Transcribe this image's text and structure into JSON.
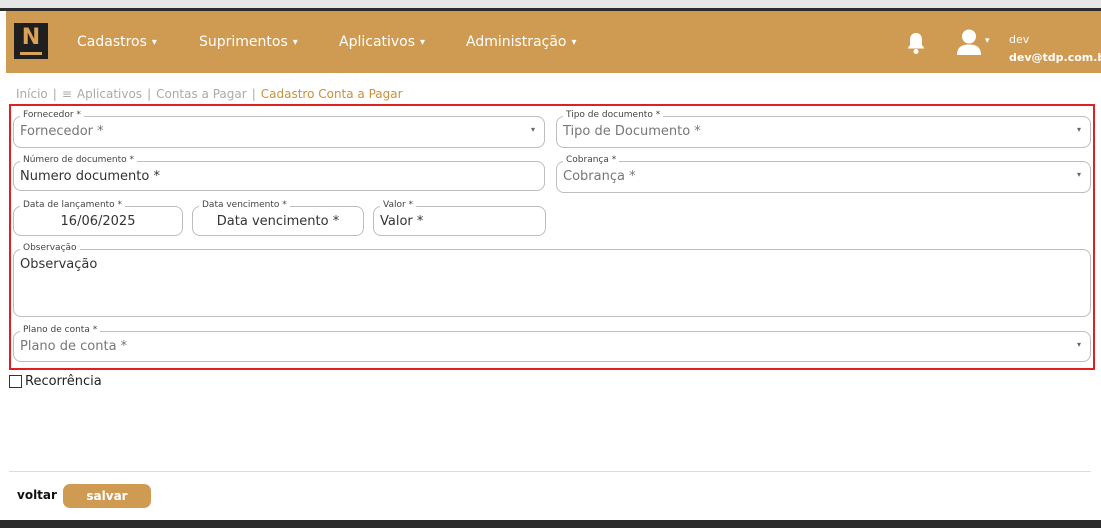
{
  "brand": {
    "logo_letter": "N",
    "accent": "#cf9a52",
    "logo_bg": "#1f1f1f"
  },
  "nav": {
    "items": [
      {
        "label": "Cadastros",
        "caret": "▾"
      },
      {
        "label": "Suprimentos",
        "caret": "▾"
      },
      {
        "label": "Aplicativos",
        "caret": "▾"
      },
      {
        "label": "Administração",
        "caret": "▾"
      }
    ],
    "notifications_icon": "bell-icon",
    "user": {
      "icon": "user-icon",
      "caret": "▾",
      "name": "dev",
      "email": "dev@tdp.com.br"
    }
  },
  "breadcrumb": {
    "home": "Início",
    "sep": "|",
    "apps_icon": "≡",
    "apps": "Aplicativos",
    "section": "Contas a Pagar",
    "current": "Cadastro Conta a Pagar"
  },
  "form": {
    "fornecedor": {
      "legend": "Fornecedor *",
      "placeholder": "Fornecedor *",
      "arrow": "▾"
    },
    "tipo_documento": {
      "legend": "Tipo de documento *",
      "placeholder": "Tipo de Documento *",
      "arrow": "▾"
    },
    "numero_documento": {
      "legend": "Número de documento *",
      "placeholder": "Numero documento *"
    },
    "cobranca": {
      "legend": "Cobrança *",
      "placeholder": "Cobrança *",
      "arrow": "▾"
    },
    "data_lancamento": {
      "legend": "Data de lançamento *",
      "value": "16/06/2025"
    },
    "data_vencimento": {
      "legend": "Data vencimento *",
      "placeholder": "Data vencimento *"
    },
    "valor": {
      "legend": "Valor *",
      "placeholder": "Valor *"
    },
    "observacao": {
      "legend": "Observação",
      "placeholder": "Observação"
    },
    "plano_conta": {
      "legend": "Plano de conta *",
      "placeholder": "Plano de conta *",
      "arrow": "▾"
    }
  },
  "recorrencia": {
    "label": "Recorrência",
    "checked": false
  },
  "footer": {
    "back_label": "voltar",
    "save_label": "salvar"
  }
}
